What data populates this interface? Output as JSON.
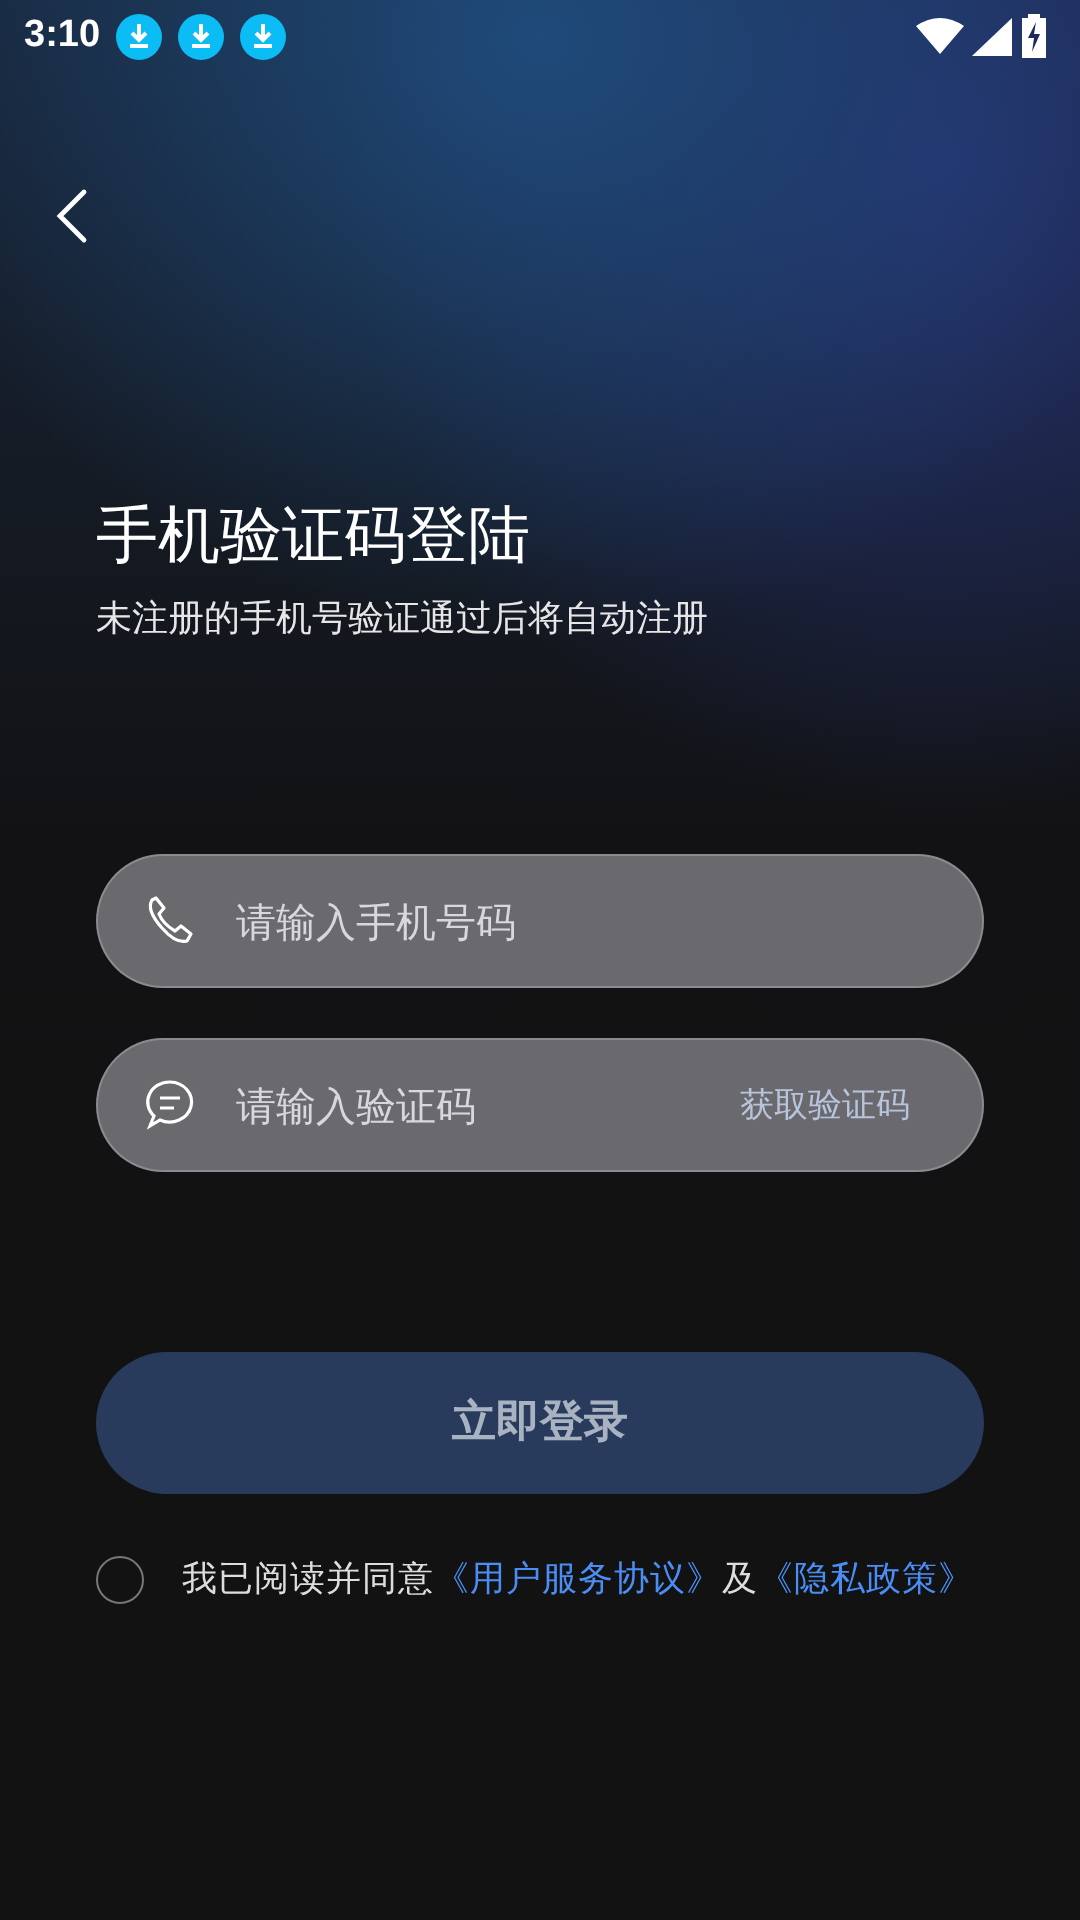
{
  "status_bar": {
    "time": "3:10",
    "notifications": [
      {
        "kind": "download"
      },
      {
        "kind": "download"
      },
      {
        "kind": "download"
      }
    ]
  },
  "title": "手机验证码登陆",
  "subtitle": "未注册的手机号验证通过后将自动注册",
  "fields": [
    {
      "kind": "phone",
      "placeholder": "请输入手机号码"
    },
    {
      "kind": "code",
      "placeholder": "请输入验证码",
      "action": "获取验证码"
    }
  ],
  "login_button": {
    "label": "立即登录",
    "disabled": true
  },
  "agreement": {
    "checked": false,
    "parts": [
      {
        "kind": "text",
        "text": "我已阅读并同意"
      },
      {
        "kind": "link",
        "text": "《用户服务协议》"
      },
      {
        "kind": "text",
        "text": "及"
      },
      {
        "kind": "link",
        "text": "《隐私政策》"
      }
    ]
  }
}
